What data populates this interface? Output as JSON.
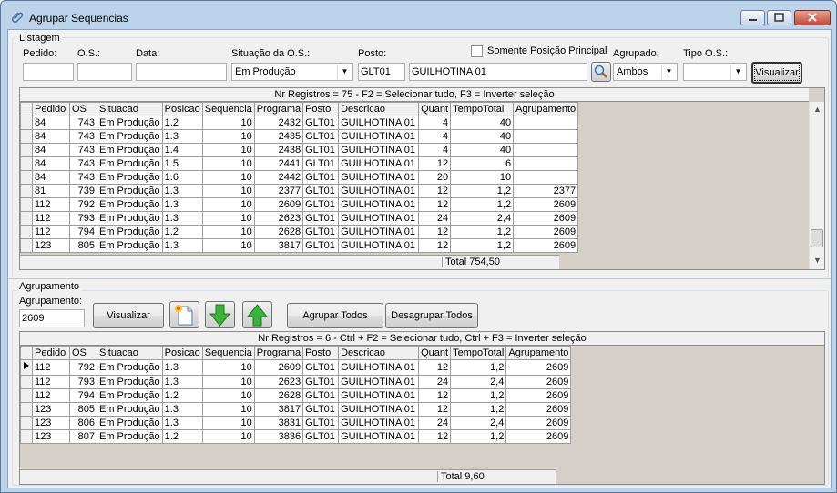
{
  "window": {
    "title": "Agrupar Sequencias"
  },
  "listagem": {
    "group_label": "Listagem",
    "labels": {
      "pedido": "Pedido:",
      "os": "O.S.:",
      "data": "Data:",
      "situacao": "Situação da O.S.:",
      "posto": "Posto:",
      "somente": "Somente Posição Principal",
      "agrupado": "Agrupado:",
      "tipo_os": "Tipo O.S.:"
    },
    "values": {
      "pedido": "",
      "os": "",
      "data": "",
      "situacao": "Em Produção",
      "posto_code": "GLT01",
      "posto_desc": "GUILHOTINA 01",
      "agrupado": "Ambos",
      "tipo_os": ""
    },
    "visualizar": "Visualizar",
    "grid": {
      "caption": "Nr Registros = 75 - F2 = Selecionar tudo, F3 = Inverter seleção",
      "columns": [
        "Pedido",
        "OS",
        "Situacao",
        "Posicao",
        "Sequencia",
        "Programa",
        "Posto",
        "Descricao",
        "Quant",
        "TempoTotal",
        "Agrupamento"
      ],
      "rows": [
        [
          "84",
          "743",
          "Em Produção",
          "1.2",
          "10",
          "2432",
          "GLT01",
          "GUILHOTINA 01",
          "4",
          "40",
          ""
        ],
        [
          "84",
          "743",
          "Em Produção",
          "1.3",
          "10",
          "2435",
          "GLT01",
          "GUILHOTINA 01",
          "4",
          "40",
          ""
        ],
        [
          "84",
          "743",
          "Em Produção",
          "1.4",
          "10",
          "2438",
          "GLT01",
          "GUILHOTINA 01",
          "4",
          "40",
          ""
        ],
        [
          "84",
          "743",
          "Em Produção",
          "1.5",
          "10",
          "2441",
          "GLT01",
          "GUILHOTINA 01",
          "12",
          "6",
          ""
        ],
        [
          "84",
          "743",
          "Em Produção",
          "1.6",
          "10",
          "2442",
          "GLT01",
          "GUILHOTINA 01",
          "20",
          "10",
          ""
        ],
        [
          "81",
          "739",
          "Em Produção",
          "1.3",
          "10",
          "2377",
          "GLT01",
          "GUILHOTINA 01",
          "12",
          "1,2",
          "2377"
        ],
        [
          "112",
          "792",
          "Em Produção",
          "1.3",
          "10",
          "2609",
          "GLT01",
          "GUILHOTINA 01",
          "12",
          "1,2",
          "2609"
        ],
        [
          "112",
          "793",
          "Em Produção",
          "1.3",
          "10",
          "2623",
          "GLT01",
          "GUILHOTINA 01",
          "24",
          "2,4",
          "2609"
        ],
        [
          "112",
          "794",
          "Em Produção",
          "1.2",
          "10",
          "2628",
          "GLT01",
          "GUILHOTINA 01",
          "12",
          "1,2",
          "2609"
        ],
        [
          "123",
          "805",
          "Em Produção",
          "1.3",
          "10",
          "3817",
          "GLT01",
          "GUILHOTINA 01",
          "12",
          "1,2",
          "2609"
        ]
      ],
      "total": "Total 754,50"
    }
  },
  "agrupamento": {
    "group_label": "Agrupamento",
    "label": "Agrupamento:",
    "value": "2609",
    "visualizar": "Visualizar",
    "agrupar_todos": "Agrupar Todos",
    "desagrupar_todos": "Desagrupar Todos",
    "grid": {
      "caption": "Nr Registros = 6 - Ctrl + F2 = Selecionar tudo, Ctrl + F3 = Inverter seleção",
      "columns": [
        "Pedido",
        "OS",
        "Situacao",
        "Posicao",
        "Sequencia",
        "Programa",
        "Posto",
        "Descricao",
        "Quant",
        "TempoTotal",
        "Agrupamento"
      ],
      "rows": [
        [
          "112",
          "792",
          "Em Produção",
          "1.3",
          "10",
          "2609",
          "GLT01",
          "GUILHOTINA 01",
          "12",
          "1,2",
          "2609"
        ],
        [
          "112",
          "793",
          "Em Produção",
          "1.3",
          "10",
          "2623",
          "GLT01",
          "GUILHOTINA 01",
          "24",
          "2,4",
          "2609"
        ],
        [
          "112",
          "794",
          "Em Produção",
          "1.2",
          "10",
          "2628",
          "GLT01",
          "GUILHOTINA 01",
          "12",
          "1,2",
          "2609"
        ],
        [
          "123",
          "805",
          "Em Produção",
          "1.3",
          "10",
          "3817",
          "GLT01",
          "GUILHOTINA 01",
          "12",
          "1,2",
          "2609"
        ],
        [
          "123",
          "806",
          "Em Produção",
          "1.3",
          "10",
          "3831",
          "GLT01",
          "GUILHOTINA 01",
          "24",
          "2,4",
          "2609"
        ],
        [
          "123",
          "807",
          "Em Produção",
          "1.2",
          "10",
          "3836",
          "GLT01",
          "GUILHOTINA 01",
          "12",
          "1,2",
          "2609"
        ]
      ],
      "total": "Total 9,60"
    }
  },
  "icons": {
    "title": "paperclip-icon",
    "search": "magnifier-icon",
    "new": "new-document-icon",
    "down": "green-arrow-down-icon",
    "up": "green-arrow-up-icon"
  }
}
